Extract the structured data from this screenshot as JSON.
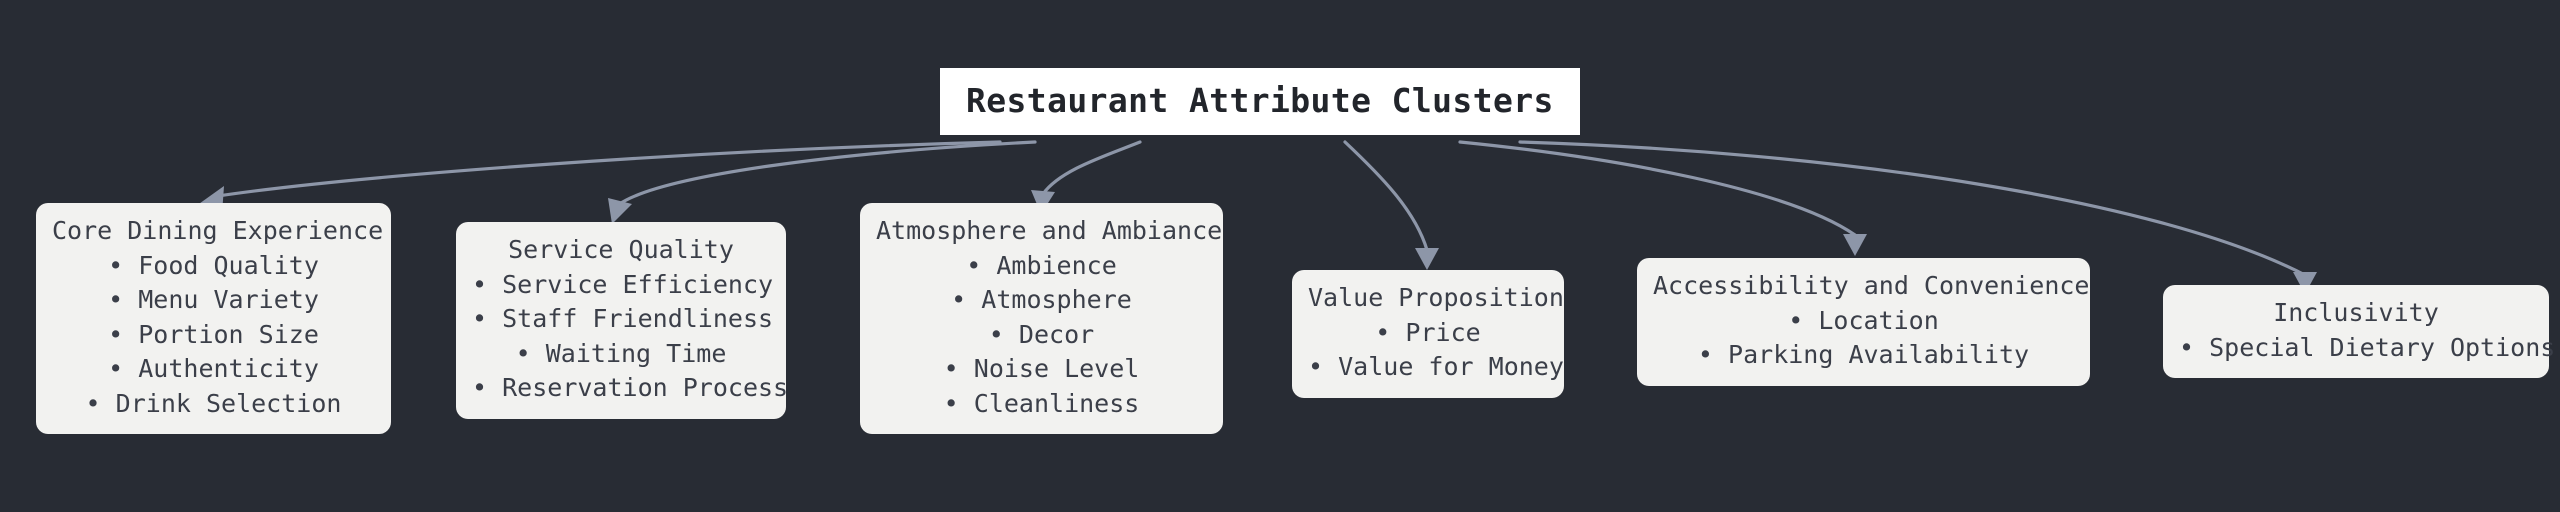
{
  "diagram": {
    "title": "Restaurant Attribute Clusters",
    "background_color": "#282c34",
    "node_fill_color": "#f2f2f0",
    "root_fill_color": "#ffffff",
    "edge_color": "#8d96a8",
    "text_color": "#3b3f49",
    "bullet": "•"
  },
  "root": {
    "label": "Restaurant Attribute Clusters"
  },
  "clusters": [
    {
      "title": "Core Dining Experience",
      "items": [
        "Food Quality",
        "Menu Variety",
        "Portion Size",
        "Authenticity",
        "Drink Selection"
      ]
    },
    {
      "title": "Service Quality",
      "items": [
        "Service Efficiency",
        "Staff Friendliness",
        "Waiting Time",
        "Reservation Process"
      ]
    },
    {
      "title": "Atmosphere and Ambiance",
      "items": [
        "Ambience",
        "Atmosphere",
        "Decor",
        "Noise Level",
        "Cleanliness"
      ]
    },
    {
      "title": "Value Proposition",
      "items": [
        "Price",
        "Value for Money"
      ]
    },
    {
      "title": "Accessibility and Convenience",
      "items": [
        "Location",
        "Parking Availability"
      ]
    },
    {
      "title": "Inclusivity",
      "items": [
        "Special Dietary Options"
      ]
    }
  ]
}
